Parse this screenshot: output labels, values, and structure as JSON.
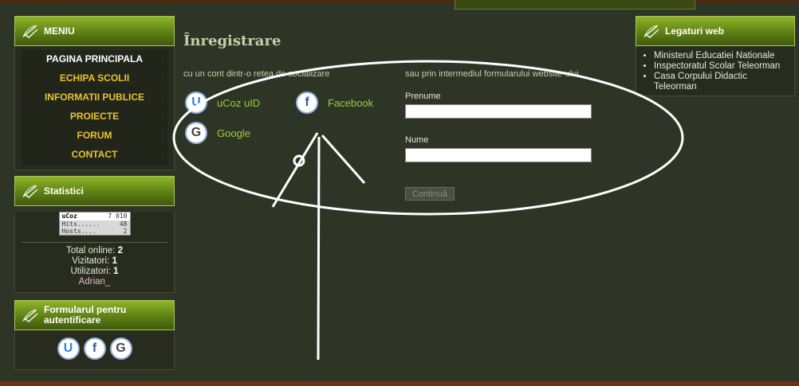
{
  "menu": {
    "title": "MENIU",
    "items": [
      {
        "label": "PAGINA PRINCIPALA"
      },
      {
        "label": "ECHIPA SCOLII"
      },
      {
        "label": "INFORMATII PUBLICE"
      },
      {
        "label": "PROIECTE"
      },
      {
        "label": "FORUM"
      },
      {
        "label": "CONTACT"
      }
    ]
  },
  "stats": {
    "title": "Statistici",
    "counter": {
      "logo": "uCoz",
      "total": "7 010",
      "hits_label": "Hits......",
      "hits": "48",
      "hosts_label": "Hosts....",
      "hosts": "2"
    },
    "total_online_label": "Total online:",
    "total_online": "2",
    "visitors_label": "Vizitatori:",
    "visitors": "1",
    "users_label": "Utilizatori:",
    "users": "1",
    "user_name": "Adrian_"
  },
  "auth": {
    "title_line1": "Formularul pentru",
    "title_line2": "autentificare",
    "icons": [
      "ucoz-icon",
      "facebook-icon",
      "google-icon"
    ],
    "u_glyph": "U",
    "f_glyph": "f",
    "g_glyph": "G"
  },
  "links": {
    "title": "Legaturi web",
    "items": [
      "Ministerul Educatiei Nationale",
      "Inspectoratul Scolar Teleorman",
      "Casa Corpului Didactic Teleorman"
    ]
  },
  "register": {
    "title": "Înregistrare",
    "social_caption": "cu un cont dintr-o retea de socializare",
    "form_caption": "sau prin intermediul formularului website-ului",
    "social": {
      "ucoz": "uCoz uID",
      "facebook": "Facebook",
      "google": "Google"
    },
    "first_name_label": "Prenume",
    "first_name_value": "",
    "last_name_label": "Nume",
    "last_name_value": "",
    "submit_label": "Continuă"
  },
  "colors": {
    "accent": "#5d8014",
    "menu_text": "#e8c230",
    "link_green": "#9ccc3a",
    "page_bg": "#2f3526",
    "annotation": "#ffffff"
  }
}
